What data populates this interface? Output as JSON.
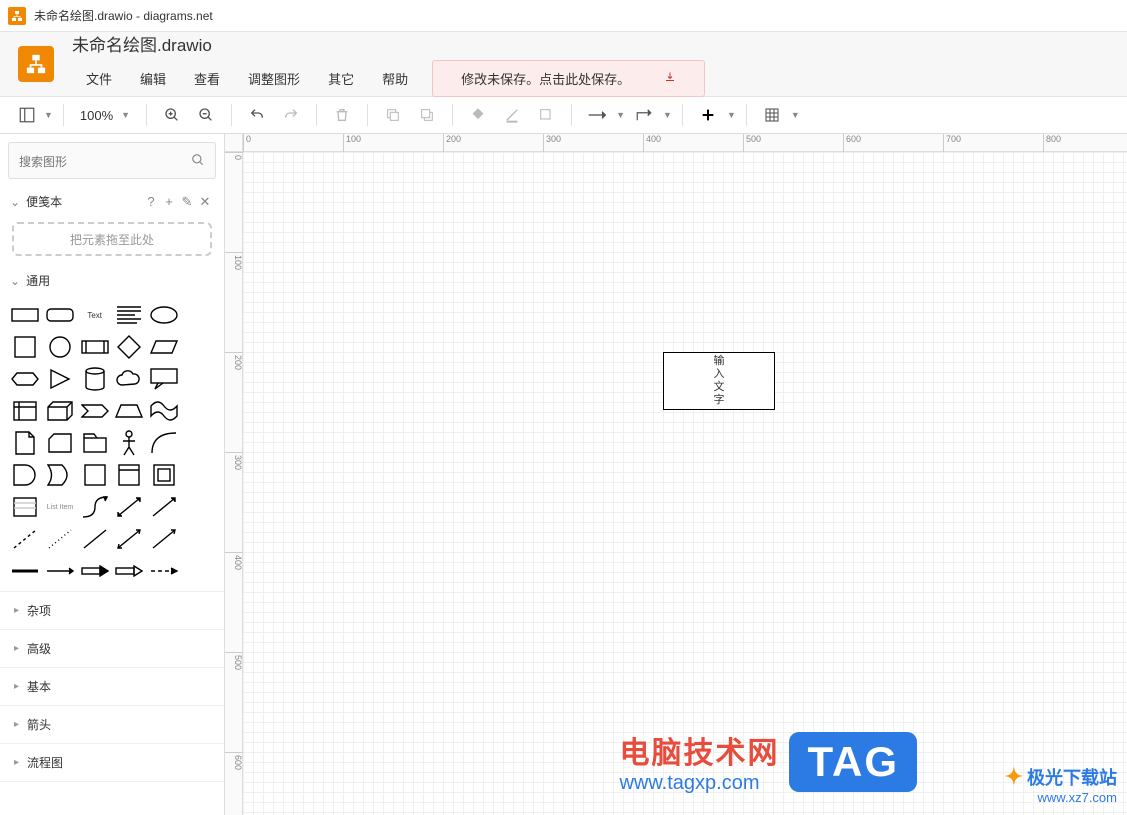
{
  "window": {
    "title": "未命名绘图.drawio - diagrams.net"
  },
  "header": {
    "doc_title": "未命名绘图.drawio",
    "menu": {
      "file": "文件",
      "edit": "编辑",
      "view": "查看",
      "format": "调整图形",
      "extras": "其它",
      "help": "帮助"
    },
    "save_notice": "修改未保存。点击此处保存。"
  },
  "toolbar": {
    "zoom": "100%"
  },
  "sidebar": {
    "search_placeholder": "搜索图形",
    "scratchpad_label": "便笺本",
    "dropzone": "把元素拖至此处",
    "general_label": "通用",
    "shape_text": "Text",
    "categories": [
      "杂项",
      "高级",
      "基本",
      "箭头",
      "流程图"
    ]
  },
  "ruler": {
    "h": [
      "0",
      "100",
      "200",
      "300",
      "400",
      "500",
      "600",
      "700",
      "800"
    ],
    "v": [
      "0",
      "100",
      "200",
      "300",
      "400",
      "500",
      "600"
    ]
  },
  "canvas": {
    "box_lines": [
      "输",
      "入",
      "文",
      "字"
    ]
  },
  "watermarks": {
    "w1_l1": "电脑技术网",
    "w1_l2": "www.tagxp.com",
    "w1_tag": "TAG",
    "w2_l1": "极光下载站",
    "w2_l2": "www.xz7.com"
  }
}
